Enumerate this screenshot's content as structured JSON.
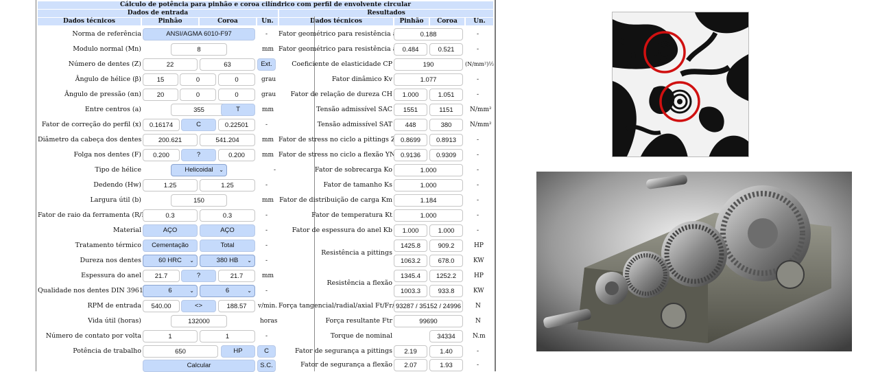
{
  "title": "Cálculo de potência para pinhão e coroa cilíndrico com perfil de envolvente circular",
  "input_section": {
    "title": "Dados de entrada",
    "col_headers": {
      "label": "Dados técnicos",
      "pinion": "Pinhão",
      "gear": "Coroa",
      "unit": "Un."
    },
    "rows": {
      "norma": {
        "label": "Norma de referência",
        "value": "ANSI/AGMA 6010-F97",
        "unit": "-"
      },
      "modulo": {
        "label": "Modulo normal (Mn)",
        "value": "8",
        "unit": "mm"
      },
      "dentes": {
        "label": "Número de dentes (Z)",
        "pinion": "22",
        "gear": "63",
        "button": "Ext."
      },
      "helice": {
        "label": "Ângulo de hélice (β)",
        "pinion": "15",
        "v2": "0",
        "v3": "0",
        "unit": "grau"
      },
      "pressao": {
        "label": "Ângulo de pressão (αn)",
        "pinion": "20",
        "v2": "0",
        "v3": "0",
        "unit": "grau"
      },
      "centros": {
        "label": "Entre centros (a)",
        "value": "355",
        "button": "T",
        "unit": "mm"
      },
      "correcao": {
        "label": "Fator de correção do perfil (x)",
        "pinion": "0.16174",
        "button": "C",
        "gear": "0.22501",
        "unit": "-"
      },
      "cabeca": {
        "label": "Diâmetro da cabeça dos dentes (Da)",
        "pinion": "200.621",
        "gear": "541.204",
        "unit": "mm"
      },
      "folga": {
        "label": "Folga nos dentes (F)",
        "pinion": "0.200",
        "button": "?",
        "gear": "0.200",
        "unit": "mm"
      },
      "tipo": {
        "label": "Tipo de hélice",
        "value": "Helicoidal",
        "unit": "-"
      },
      "dedendo": {
        "label": "Dedendo (Hw)",
        "pinion": "1.25",
        "gear": "1.25",
        "unit": "-"
      },
      "largura": {
        "label": "Largura útil (b)",
        "value": "150",
        "unit": "mm"
      },
      "raio": {
        "label": "Fator de raio da ferramenta (R/Mn)",
        "pinion": "0.3",
        "gear": "0.3",
        "unit": "-"
      },
      "material": {
        "label": "Material",
        "pinion": "AÇO",
        "gear": "AÇO",
        "unit": "-"
      },
      "tratamento": {
        "label": "Tratamento térmico",
        "pinion": "Cementação",
        "gear": "Total",
        "unit": "-"
      },
      "dureza": {
        "label": "Dureza nos dentes",
        "pinion": "60 HRC",
        "gear": "380 HB",
        "unit": "-"
      },
      "espessura": {
        "label": "Espessura do anel",
        "pinion": "21.7",
        "button": "?",
        "gear": "21.7",
        "unit": "mm"
      },
      "qualidade": {
        "label": "Qualidade nos dentes DIN 3961",
        "pinion": "6",
        "gear": "6",
        "unit": "-"
      },
      "rpm": {
        "label": "RPM de entrada",
        "pinion": "540.00",
        "button": "<>",
        "gear": "188.57",
        "unit": "v/min."
      },
      "vida": {
        "label": "Vida útil (horas)",
        "value": "132000",
        "unit": "horas"
      },
      "contato": {
        "label": "Número de contato por volta",
        "pinion": "1",
        "gear": "1",
        "unit": "-"
      },
      "potencia": {
        "label": "Potência de trabalho",
        "value": "650",
        "button": "HP",
        "button2": "C"
      },
      "calcular": {
        "button": "Calcular",
        "button2": "S.C."
      }
    }
  },
  "results_section": {
    "title": "Resultados",
    "col_headers": {
      "label": "Dados técnicos",
      "pinion": "Pinhão",
      "gear": "Coroa",
      "unit": "Un."
    },
    "rows": {
      "pitting": {
        "label": "Fator geométrico para resistência a pittings",
        "value": "0.188",
        "unit": "-"
      },
      "flexao": {
        "label": "Fator geométrico para resistência a flexão",
        "pinion": "0.484",
        "gear": "0.521",
        "unit": "-"
      },
      "elasticidade": {
        "label": "Coeficiente de elasticidade CP",
        "value": "190",
        "unit": "(N/mm²)½"
      },
      "dinamico": {
        "label": "Fator dinâmico Kv",
        "value": "1.077",
        "unit": "-"
      },
      "dureza": {
        "label": "Fator de relação de dureza CH",
        "pinion": "1.000",
        "gear": "1.051",
        "unit": "-"
      },
      "sac": {
        "label": "Tensão admissível SAC",
        "pinion": "1551",
        "gear": "1151",
        "unit": "N/mm²"
      },
      "sat": {
        "label": "Tensão admissível SAT",
        "pinion": "448",
        "gear": "380",
        "unit": "N/mm²"
      },
      "zn": {
        "label": "Fator de stress no ciclo a pittings ZN",
        "pinion": "0.8699",
        "gear": "0.8913",
        "unit": "-"
      },
      "yn": {
        "label": "Fator de stress no ciclo a flexão YN",
        "pinion": "0.9136",
        "gear": "0.9309",
        "unit": "-"
      },
      "ko": {
        "label": "Fator de sobrecarga Ko",
        "value": "1.000",
        "unit": "-"
      },
      "ks": {
        "label": "Fator de tamanho Ks",
        "value": "1.000",
        "unit": "-"
      },
      "km": {
        "label": "Fator de distribuição de carga Km",
        "value": "1.184",
        "unit": "-"
      },
      "kt": {
        "label": "Fator de temperatura Kt",
        "value": "1.000",
        "unit": "-"
      },
      "kb": {
        "label": "Fator de espessura do anel Kb",
        "pinion": "1.000",
        "gear": "1.000",
        "unit": "-"
      },
      "res_pitting": {
        "label": "Resistência a pittings",
        "hp_p": "1425.8",
        "hp_g": "909.2",
        "hp_unit": "HP",
        "kw_p": "1063.2",
        "kw_g": "678.0",
        "kw_unit": "KW"
      },
      "res_flexao": {
        "label": "Resistência a flexão",
        "hp_p": "1345.4",
        "hp_g": "1252.2",
        "hp_unit": "HP",
        "kw_p": "1003.3",
        "kw_g": "933.8",
        "kw_unit": "KW"
      },
      "forca": {
        "label": "Força tangencial/radial/axial Ft/Fr/Fa",
        "value": "93287 / 35152 / 24996",
        "unit": "N"
      },
      "resultante": {
        "label": "Força resultante Ftr",
        "value": "99690",
        "unit": "N"
      },
      "torque": {
        "label": "Torque de nominal",
        "gear": "34334",
        "unit": "N.m"
      },
      "seg_pitting": {
        "label": "Fator de segurança a pittings",
        "pinion": "2.19",
        "gear": "1.40",
        "unit": "-"
      },
      "seg_flexao": {
        "label": "Fator de segurança a flexão",
        "pinion": "2.07",
        "gear": "1.93",
        "unit": "-"
      }
    }
  },
  "images": {
    "photoelastic": "photoelastic-stress-image",
    "gearbox": "gearbox-render-image"
  },
  "colors": {
    "header": "#cfe0fc",
    "button": "#c5dafb",
    "highlight_circle": "#d01010"
  }
}
